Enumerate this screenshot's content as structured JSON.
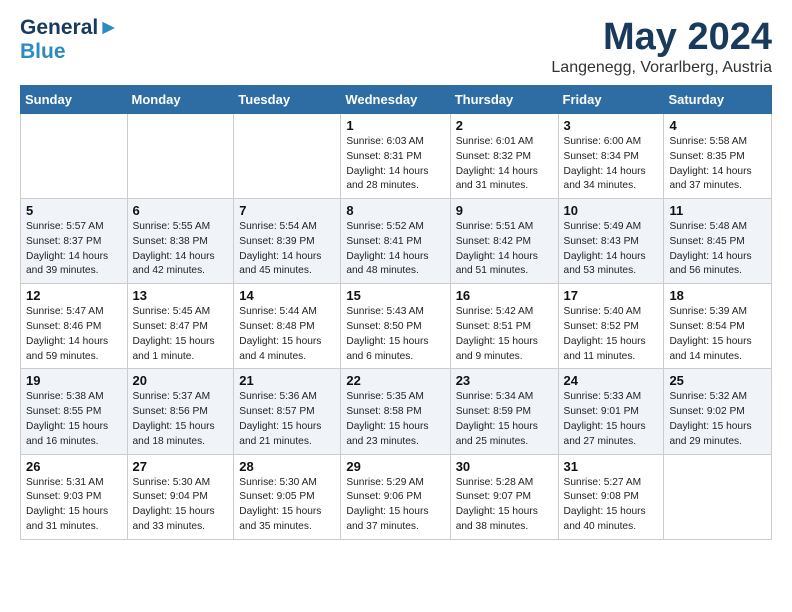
{
  "header": {
    "logo_line1": "General",
    "logo_line2": "Blue",
    "month_year": "May 2024",
    "location": "Langenegg, Vorarlberg, Austria"
  },
  "days_of_week": [
    "Sunday",
    "Monday",
    "Tuesday",
    "Wednesday",
    "Thursday",
    "Friday",
    "Saturday"
  ],
  "weeks": [
    [
      {
        "day": "",
        "text": ""
      },
      {
        "day": "",
        "text": ""
      },
      {
        "day": "",
        "text": ""
      },
      {
        "day": "1",
        "text": "Sunrise: 6:03 AM\nSunset: 8:31 PM\nDaylight: 14 hours\nand 28 minutes."
      },
      {
        "day": "2",
        "text": "Sunrise: 6:01 AM\nSunset: 8:32 PM\nDaylight: 14 hours\nand 31 minutes."
      },
      {
        "day": "3",
        "text": "Sunrise: 6:00 AM\nSunset: 8:34 PM\nDaylight: 14 hours\nand 34 minutes."
      },
      {
        "day": "4",
        "text": "Sunrise: 5:58 AM\nSunset: 8:35 PM\nDaylight: 14 hours\nand 37 minutes."
      }
    ],
    [
      {
        "day": "5",
        "text": "Sunrise: 5:57 AM\nSunset: 8:37 PM\nDaylight: 14 hours\nand 39 minutes."
      },
      {
        "day": "6",
        "text": "Sunrise: 5:55 AM\nSunset: 8:38 PM\nDaylight: 14 hours\nand 42 minutes."
      },
      {
        "day": "7",
        "text": "Sunrise: 5:54 AM\nSunset: 8:39 PM\nDaylight: 14 hours\nand 45 minutes."
      },
      {
        "day": "8",
        "text": "Sunrise: 5:52 AM\nSunset: 8:41 PM\nDaylight: 14 hours\nand 48 minutes."
      },
      {
        "day": "9",
        "text": "Sunrise: 5:51 AM\nSunset: 8:42 PM\nDaylight: 14 hours\nand 51 minutes."
      },
      {
        "day": "10",
        "text": "Sunrise: 5:49 AM\nSunset: 8:43 PM\nDaylight: 14 hours\nand 53 minutes."
      },
      {
        "day": "11",
        "text": "Sunrise: 5:48 AM\nSunset: 8:45 PM\nDaylight: 14 hours\nand 56 minutes."
      }
    ],
    [
      {
        "day": "12",
        "text": "Sunrise: 5:47 AM\nSunset: 8:46 PM\nDaylight: 14 hours\nand 59 minutes."
      },
      {
        "day": "13",
        "text": "Sunrise: 5:45 AM\nSunset: 8:47 PM\nDaylight: 15 hours\nand 1 minute."
      },
      {
        "day": "14",
        "text": "Sunrise: 5:44 AM\nSunset: 8:48 PM\nDaylight: 15 hours\nand 4 minutes."
      },
      {
        "day": "15",
        "text": "Sunrise: 5:43 AM\nSunset: 8:50 PM\nDaylight: 15 hours\nand 6 minutes."
      },
      {
        "day": "16",
        "text": "Sunrise: 5:42 AM\nSunset: 8:51 PM\nDaylight: 15 hours\nand 9 minutes."
      },
      {
        "day": "17",
        "text": "Sunrise: 5:40 AM\nSunset: 8:52 PM\nDaylight: 15 hours\nand 11 minutes."
      },
      {
        "day": "18",
        "text": "Sunrise: 5:39 AM\nSunset: 8:54 PM\nDaylight: 15 hours\nand 14 minutes."
      }
    ],
    [
      {
        "day": "19",
        "text": "Sunrise: 5:38 AM\nSunset: 8:55 PM\nDaylight: 15 hours\nand 16 minutes."
      },
      {
        "day": "20",
        "text": "Sunrise: 5:37 AM\nSunset: 8:56 PM\nDaylight: 15 hours\nand 18 minutes."
      },
      {
        "day": "21",
        "text": "Sunrise: 5:36 AM\nSunset: 8:57 PM\nDaylight: 15 hours\nand 21 minutes."
      },
      {
        "day": "22",
        "text": "Sunrise: 5:35 AM\nSunset: 8:58 PM\nDaylight: 15 hours\nand 23 minutes."
      },
      {
        "day": "23",
        "text": "Sunrise: 5:34 AM\nSunset: 8:59 PM\nDaylight: 15 hours\nand 25 minutes."
      },
      {
        "day": "24",
        "text": "Sunrise: 5:33 AM\nSunset: 9:01 PM\nDaylight: 15 hours\nand 27 minutes."
      },
      {
        "day": "25",
        "text": "Sunrise: 5:32 AM\nSunset: 9:02 PM\nDaylight: 15 hours\nand 29 minutes."
      }
    ],
    [
      {
        "day": "26",
        "text": "Sunrise: 5:31 AM\nSunset: 9:03 PM\nDaylight: 15 hours\nand 31 minutes."
      },
      {
        "day": "27",
        "text": "Sunrise: 5:30 AM\nSunset: 9:04 PM\nDaylight: 15 hours\nand 33 minutes."
      },
      {
        "day": "28",
        "text": "Sunrise: 5:30 AM\nSunset: 9:05 PM\nDaylight: 15 hours\nand 35 minutes."
      },
      {
        "day": "29",
        "text": "Sunrise: 5:29 AM\nSunset: 9:06 PM\nDaylight: 15 hours\nand 37 minutes."
      },
      {
        "day": "30",
        "text": "Sunrise: 5:28 AM\nSunset: 9:07 PM\nDaylight: 15 hours\nand 38 minutes."
      },
      {
        "day": "31",
        "text": "Sunrise: 5:27 AM\nSunset: 9:08 PM\nDaylight: 15 hours\nand 40 minutes."
      },
      {
        "day": "",
        "text": ""
      }
    ]
  ]
}
